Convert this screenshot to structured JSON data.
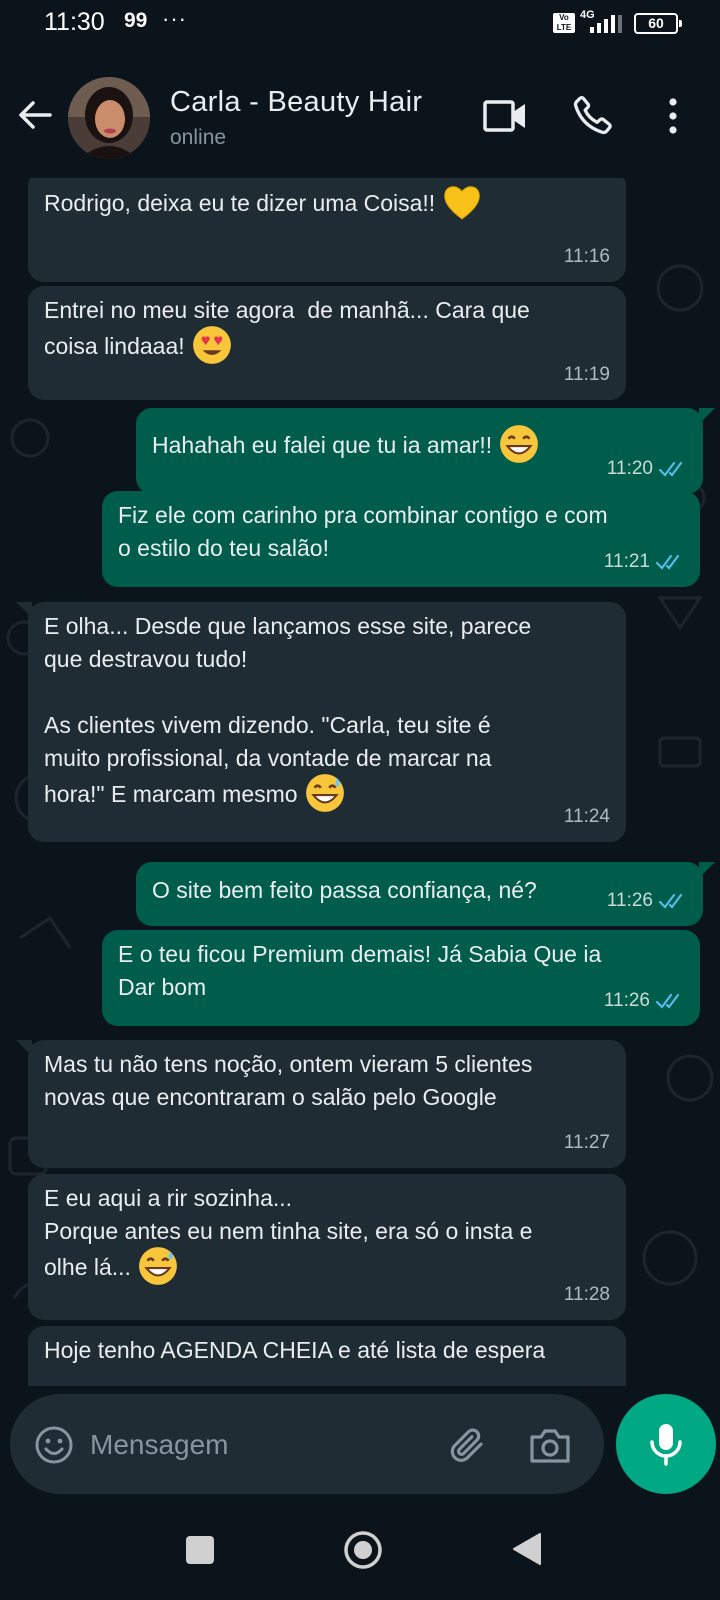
{
  "status_bar": {
    "time": "11:30",
    "notification": "99",
    "more": "···",
    "volte": "Vo LTE",
    "network": "4G",
    "battery": "60"
  },
  "header": {
    "name": "Carla - Beauty Hair",
    "status": "online"
  },
  "messages": [
    {
      "dir": "in",
      "text": "Rodrigo, deixa eu te dizer uma Coisa!!",
      "emoji": "yellow-heart",
      "time": "11:16"
    },
    {
      "dir": "in",
      "text": "Entrei no meu site agora  de manhã... Cara que\ncoisa lindaaa!",
      "emoji": "heart-eyes",
      "time": "11:19"
    },
    {
      "dir": "out",
      "text": "Hahahah eu falei que tu ia amar!!",
      "emoji": "grin",
      "time": "11:20",
      "read": true
    },
    {
      "dir": "out",
      "text": "Fiz ele com carinho pra combinar contigo e com\no estilo do teu salão!",
      "time": "11:21",
      "read": true
    },
    {
      "dir": "in",
      "text": "E olha... Desde que lançamos esse site, parece\nque destravou tudo!\n\nAs clientes vivem dizendo. \"Carla, teu site é\nmuito profissional, da vontade de marcar na\nhora!\" E marcam mesmo",
      "emoji": "grin-sweat",
      "time": "11:24"
    },
    {
      "dir": "out",
      "text": "O site bem feito passa confiança, né?",
      "time": "11:26",
      "read": true
    },
    {
      "dir": "out",
      "text": "E o teu ficou Premium demais! Já Sabia Que ia\nDar bom",
      "time": "11:26",
      "read": true
    },
    {
      "dir": "in",
      "text": "Mas tu não tens noção, ontem vieram 5 clientes\nnovas que encontraram o salão pelo Google",
      "time": "11:27"
    },
    {
      "dir": "in",
      "text": "E eu aqui a rir sozinha...\nPorque antes eu nem tinha site, era só o insta e\nolhe lá...",
      "emoji": "grin-sweat",
      "time": "11:28"
    },
    {
      "dir": "in",
      "text": "Hoje tenho AGENDA CHEIA e até lista de espera",
      "time": ""
    }
  ],
  "input": {
    "placeholder": "Mensagem"
  },
  "colors": {
    "background": "#0b141a",
    "incoming_bubble": "#202c33",
    "outgoing_bubble": "#005c4b",
    "accent": "#00a884",
    "read_ticks": "#53bdeb"
  },
  "icons": {
    "back": "arrow-left-icon",
    "video": "video-camera-icon",
    "call": "phone-icon",
    "menu": "kebab-menu-icon",
    "emoji": "smiley-icon",
    "attach": "paperclip-icon",
    "camera": "camera-icon",
    "mic": "microphone-icon"
  }
}
